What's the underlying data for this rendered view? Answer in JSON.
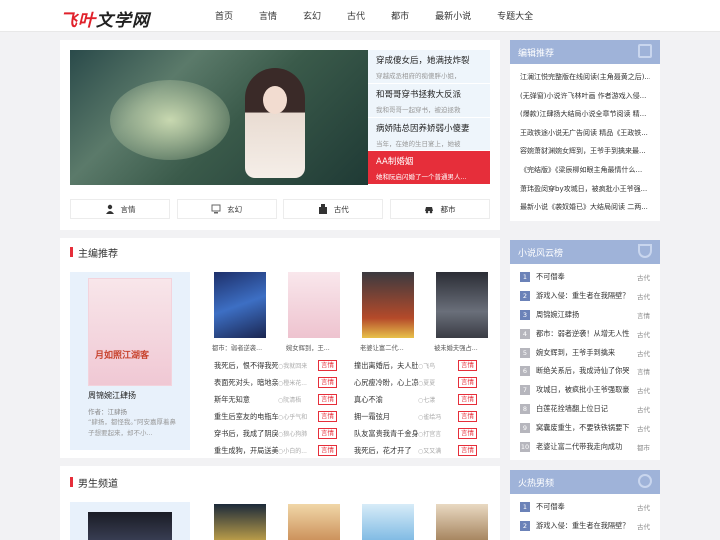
{
  "brand": {
    "logo_red": "飞叶",
    "logo_black": "文学网"
  },
  "nav": [
    "首页",
    "言情",
    "玄幻",
    "古代",
    "都市",
    "最新小说",
    "专题大全"
  ],
  "banner": [
    {
      "title": "穿成傻女后，她满技炸裂",
      "desc": "穿越成丞相府的痴傻胖小姐，"
    },
    {
      "title": "和哥哥穿书拯救大反派",
      "desc": "我和哥哥一起穿书，被迫拯救"
    },
    {
      "title": "病娇陆总因养娇弱小傻妻",
      "desc": "当年，在她的生日宴上，她被"
    },
    {
      "title": "AA制婚姻",
      "desc": "她和阮启闪婚了一个普通男人..."
    }
  ],
  "cats": [
    "言情",
    "玄幻",
    "古代",
    "都市"
  ],
  "editor": {
    "title": "主编推荐",
    "feature": {
      "cover": "月如照江湖客",
      "name": "周锦婉江肆扬",
      "author": "作者：江肆扬",
      "desc": "“肆扬，都怪我。”阿安嘉厚着鼻子想要起来，却不小..."
    },
    "books": [
      "都市：弱者逆袭...",
      "婉女辉到，王...",
      "老婆让富二代...",
      "被未婚夫强占..."
    ],
    "rows": [
      [
        "我死后，恨不得我死",
        "○我就回来",
        "言情",
        "撞出离婚后，夫人肚...",
        "○飞鸟",
        "言情"
      ],
      [
        "表面死对头，暗地亲...",
        "○橙米花...",
        "言情",
        "心尻瘦冷盼，心上凉...",
        "○夏夏",
        "言情"
      ],
      [
        "斯年无知意",
        "○阮清梧",
        "言情",
        "真心不渝",
        "○七漾",
        "言情"
      ],
      [
        "重生后室友的电瓶车...",
        "○心乎气和",
        "言情",
        "拥一霜弦月",
        "○雀给冯",
        "言情"
      ],
      [
        "穿书后，我成了阴戾...",
        "○狼心狗肺",
        "言情",
        "队友富贵我青千金身份",
        "○打宫言",
        "言情"
      ],
      [
        "重生成狗，开局送美...",
        "○小白的...",
        "言情",
        "我死后，花才开了",
        "○又又满",
        "言情"
      ]
    ]
  },
  "male": {
    "title": "男生频道"
  },
  "side_recommend": {
    "title": "编辑推荐",
    "items": [
      "江澜江悦完整版在线阅读(主角聂黄之后)...",
      "(无弹窗)小说许飞林叶画 作者游戏入侵...",
      "(爆款)江肆扬大结局小说全章节阅读 精...",
      "王政铁途小说无广告阅读 精品《王政铁...",
      "容婉萧豺渊婉女辉到，王爷手到擒来最...",
      "《完结版》《梁辰柳如眼主角最情什么...",
      "萧玮盈闵穿by攻城日，被疯批小王爷强...",
      "最新小说《袭奴婚已》大结局阅读 二两..."
    ]
  },
  "side_rank": {
    "title": "小说风云榜",
    "items": [
      [
        "1",
        "不可僭奉",
        "古代"
      ],
      [
        "2",
        "游戏入侵：重生者在我隔壁？",
        "古代"
      ],
      [
        "3",
        "周锦婉江肆扬",
        "言情"
      ],
      [
        "4",
        "都市：弱者逆袭！从增无人性",
        "古代"
      ],
      [
        "5",
        "婉女辉到，王爷手到擒来",
        "古代"
      ],
      [
        "6",
        "断绝关系后，我成诗仙了你哭",
        "言情"
      ],
      [
        "7",
        "攻城日，被疯批小王爷强取豪",
        "古代"
      ],
      [
        "8",
        "白莲花拴墙翻上位日记",
        "古代"
      ],
      [
        "9",
        "窝囊废重生，不要铁铁锅要下",
        "古代"
      ],
      [
        "10",
        "老婆让富二代带我走向成功",
        "都市"
      ]
    ]
  },
  "side_hot": {
    "title": "火热男频",
    "items": [
      [
        "1",
        "不可僭奉",
        "古代"
      ],
      [
        "2",
        "游戏入侵：重生者在我隔壁？",
        "古代"
      ]
    ]
  }
}
